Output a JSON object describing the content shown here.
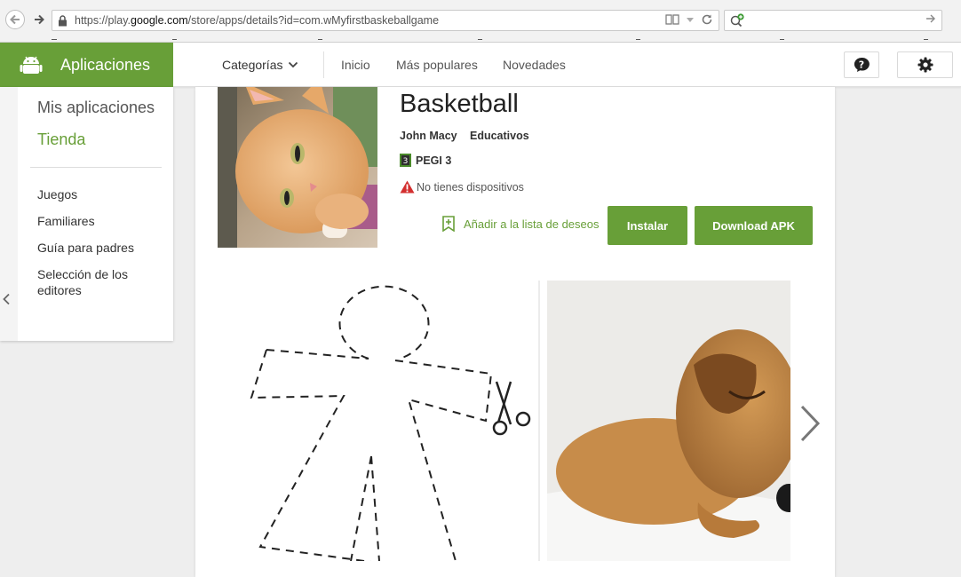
{
  "browser": {
    "url_prefix": "https://play.",
    "url_domain": "google.com",
    "url_suffix": "/store/apps/details?id=com.wMyfirstbaskeballgame",
    "icons": {
      "back": "back-arrow-icon",
      "forward": "forward-arrow-icon",
      "lock": "lock-icon",
      "reader": "reader-view-icon",
      "dropdown": "dropdown-triangle-icon",
      "reload": "reload-icon",
      "search": "search-add-icon",
      "go": "go-arrow-icon"
    }
  },
  "header": {
    "brand_label": "Aplicaciones",
    "brand_color": "#689f38",
    "categories_label": "Categorías",
    "nav": [
      "Inicio",
      "Más populares",
      "Novedades"
    ],
    "icons": {
      "help": "help-icon",
      "settings": "gear-icon",
      "android": "android-icon",
      "chevron": "chevron-down-icon"
    }
  },
  "sidebar": {
    "main_items": [
      "Mis aplicaciones",
      "Tienda"
    ],
    "sub_items": [
      "Juegos",
      "Familiares",
      "Guía para padres",
      "Selección de los editores"
    ]
  },
  "app": {
    "title": "Basketball",
    "developer": "John Macy",
    "category": "Educativos",
    "rating": "PEGI 3",
    "device_warning": "No tienes dispositivos",
    "wishlist_label": "Añadir a la lista de deseos",
    "install_label": "Instalar",
    "download_label": "Download APK"
  },
  "colors": {
    "accent": "#689f38",
    "warning": "#d32f2f"
  }
}
